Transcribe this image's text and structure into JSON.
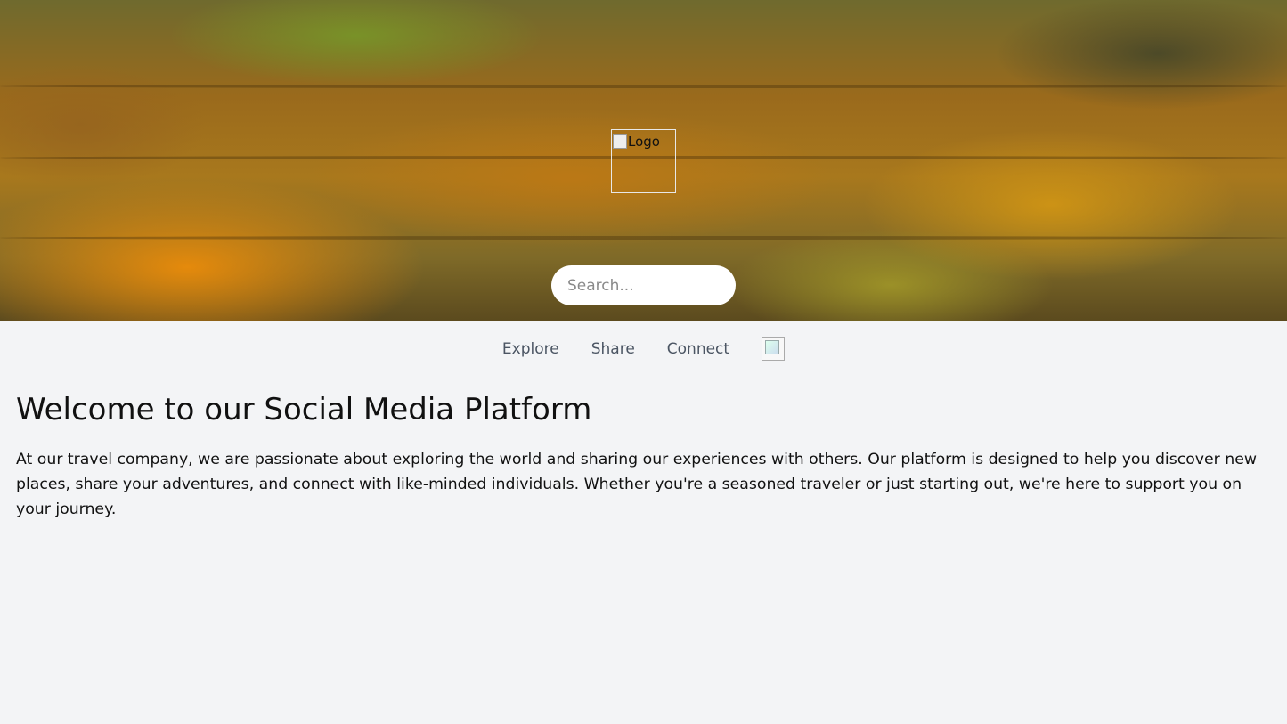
{
  "hero": {
    "logo_alt": "Logo",
    "search_placeholder": "Search..."
  },
  "nav": {
    "items": [
      {
        "label": "Explore"
      },
      {
        "label": "Share"
      },
      {
        "label": "Connect"
      }
    ],
    "profile_icon": "profile-image-icon"
  },
  "main": {
    "heading": "Welcome to our Social Media Platform",
    "paragraph": "At our travel company, we are passionate about exploring the world and sharing our experiences with others. Our platform is designed to help you discover new places, share your adventures, and connect with like-minded individuals. Whether you're a seasoned traveler or just starting out, we're here to support you on your journey."
  },
  "colors": {
    "background": "#f3f4f6",
    "nav_text": "#4b5563"
  }
}
